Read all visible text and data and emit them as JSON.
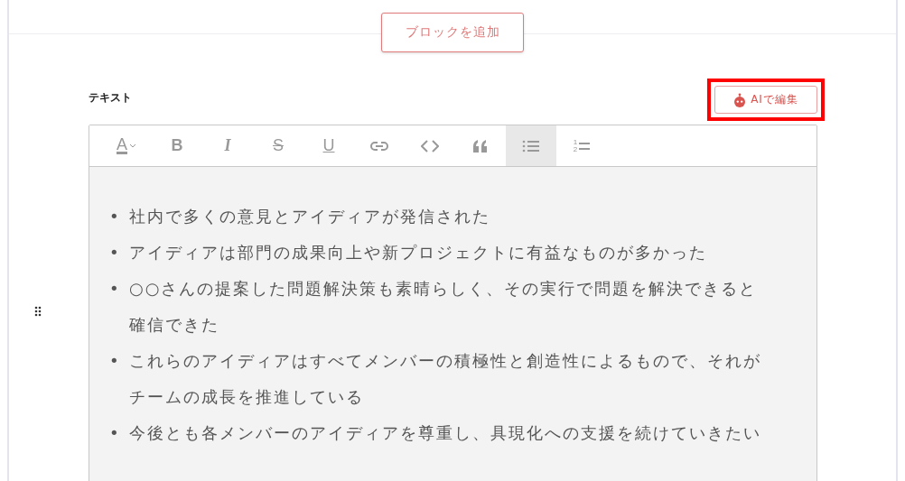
{
  "add_block_button": {
    "label": "ブロックを追加"
  },
  "block": {
    "title": "テキスト",
    "ai_button": {
      "label": "AIで編集",
      "highlighted": true
    },
    "toolbar": [
      {
        "kind": "text-color",
        "glyph": "A",
        "selected": false
      },
      {
        "kind": "bold",
        "glyph": "B",
        "selected": false
      },
      {
        "kind": "italic",
        "glyph": "I",
        "selected": false
      },
      {
        "kind": "strike",
        "glyph": "S",
        "selected": false
      },
      {
        "kind": "underline",
        "glyph": "U",
        "selected": false
      },
      {
        "kind": "link",
        "selected": false
      },
      {
        "kind": "code",
        "selected": false
      },
      {
        "kind": "quote",
        "selected": false
      },
      {
        "kind": "bullet-list",
        "selected": true
      },
      {
        "kind": "numbered-list",
        "digits": [
          "1",
          "2"
        ],
        "selected": false
      }
    ],
    "items": [
      {
        "marker": "•",
        "text": "社内で多くの意見とアイディアが発信された"
      },
      {
        "marker": "•",
        "text": "アイディアは部門の成果向上や新プロジェクトに有益なものが多かった"
      },
      {
        "marker": "•",
        "text": "○○さんの提案した問題解決策も素晴らしく、その実行で問題を解決できると確信できた"
      },
      {
        "marker": "•",
        "text": "これらのアイディアはすべてメンバーの積極性と創造性によるもので、それがチームの成長を推進している"
      },
      {
        "marker": "•",
        "text": "今後とも各メンバーのアイディアを尊重し、具現化への支援を続けていきたい"
      }
    ]
  }
}
